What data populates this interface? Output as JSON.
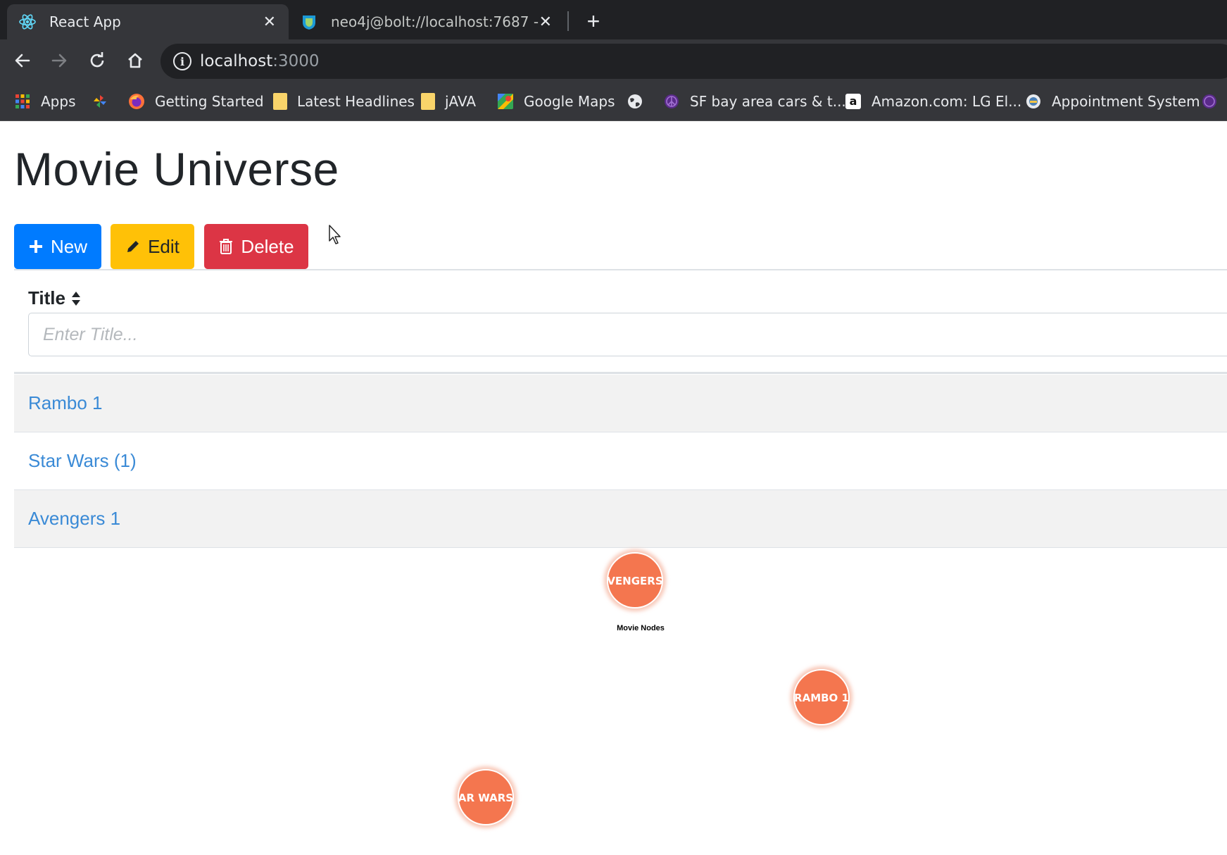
{
  "browser": {
    "tabs": [
      {
        "title": "React App",
        "active": true,
        "icon": "react-icon"
      },
      {
        "title": "neo4j@bolt://localhost:7687 - Ne",
        "active": false,
        "icon": "neo4j-icon"
      }
    ],
    "address": {
      "host": "localhost",
      "port": ":3000"
    },
    "bookmarks": [
      {
        "label": "Apps",
        "icon": "apps-grid-icon"
      },
      {
        "label": "",
        "icon": "pinwheel-icon"
      },
      {
        "label": "Getting Started",
        "icon": "firefox-icon"
      },
      {
        "label": "Latest Headlines",
        "icon": "folder-icon"
      },
      {
        "label": "jAVA",
        "icon": "folder-icon"
      },
      {
        "label": "Google Maps",
        "icon": "google-maps-icon"
      },
      {
        "label": "",
        "icon": "globe-icon"
      },
      {
        "label": "SF bay area cars & t...",
        "icon": "peace-sign-icon"
      },
      {
        "label": "Amazon.com: LG El...",
        "icon": "amazon-icon"
      },
      {
        "label": "Appointment System",
        "icon": "appointment-icon"
      }
    ]
  },
  "app": {
    "title": "Movie Universe",
    "buttons": {
      "new": "New",
      "edit": "Edit",
      "delete": "Delete"
    },
    "table": {
      "column": "Title",
      "filter_placeholder": "Enter Title...",
      "rows": [
        "Rambo 1",
        "Star Wars (1)",
        "Avengers 1"
      ]
    },
    "graph": {
      "title": "Movie Nodes",
      "node_color": "#f4764f",
      "nodes": [
        {
          "label": "VENGERS"
        },
        {
          "label": "RAMBO 1"
        },
        {
          "label": "AR WARS"
        }
      ]
    }
  },
  "colors": {
    "primary": "#007bff",
    "warning": "#ffc107",
    "danger": "#dc3545",
    "link": "#3a8ad6"
  }
}
